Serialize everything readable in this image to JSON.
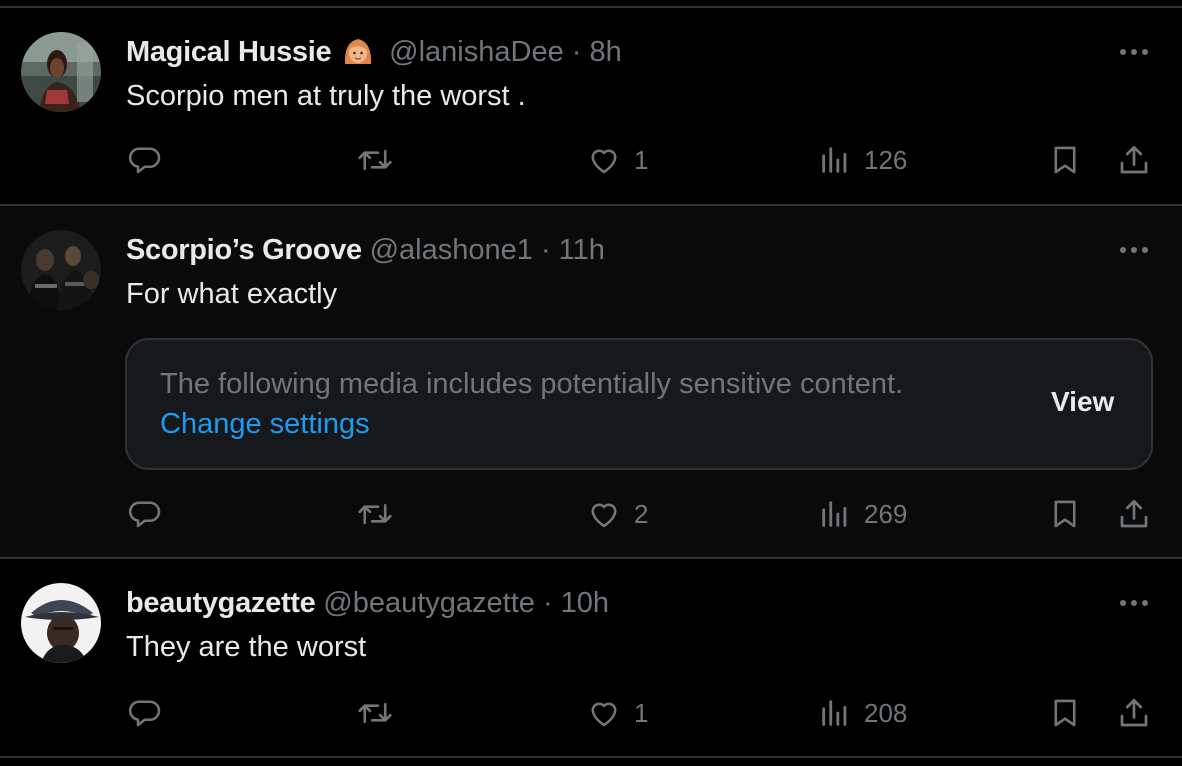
{
  "tweets": [
    {
      "display_name": "Magical Hussie",
      "has_emoji": true,
      "emoji": "woman-emoji",
      "handle": "@lanishaDee",
      "separator": "·",
      "time": "8h",
      "text": "Scorpio men at truly the worst .",
      "reply_count": "",
      "retweet_count": "",
      "like_count": "1",
      "view_count": "126"
    },
    {
      "display_name": "Scorpio’s Groove",
      "handle": "@alashone1",
      "separator": "·",
      "time": "11h",
      "text": "For what exactly",
      "sensitive": {
        "message": "The following media includes potentially sensitive content.",
        "link": "Change settings",
        "button": "View"
      },
      "reply_count": "",
      "retweet_count": "",
      "like_count": "2",
      "view_count": "269"
    },
    {
      "display_name": "beautygazette",
      "handle": "@beautygazette",
      "separator": "·",
      "time": "10h",
      "text": "They are the worst",
      "reply_count": "",
      "retweet_count": "",
      "like_count": "1",
      "view_count": "208"
    }
  ],
  "colors": {
    "background": "#000000",
    "text_primary": "#e7e9ea",
    "text_secondary": "#71767b",
    "link": "#1d9bf0",
    "divider": "#2f3336"
  }
}
